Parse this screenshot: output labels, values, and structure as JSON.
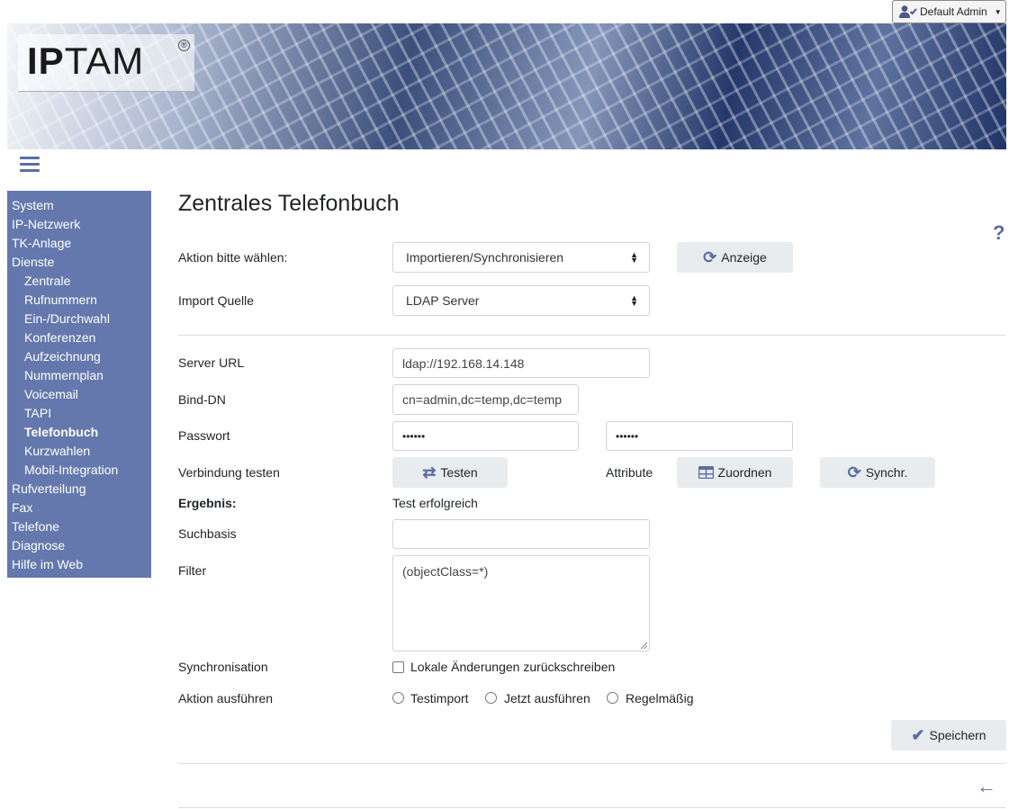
{
  "user_menu": {
    "label": "Default Admin",
    "icon": "user-check-icon"
  },
  "logo": {
    "text_bold": "IP",
    "text_rest": "TAM",
    "mark": "®"
  },
  "sidebar": {
    "items": [
      {
        "label": "System",
        "level": 0
      },
      {
        "label": "IP-Netzwerk",
        "level": 0
      },
      {
        "label": "TK-Anlage",
        "level": 0
      },
      {
        "label": "Dienste",
        "level": 0
      },
      {
        "label": "Zentrale",
        "level": 1
      },
      {
        "label": "Rufnummern",
        "level": 1
      },
      {
        "label": "Ein-/Durchwahl",
        "level": 1
      },
      {
        "label": "Konferenzen",
        "level": 1
      },
      {
        "label": "Aufzeichnung",
        "level": 1
      },
      {
        "label": "Nummernplan",
        "level": 1
      },
      {
        "label": "Voicemail",
        "level": 1
      },
      {
        "label": "TAPI",
        "level": 1
      },
      {
        "label": "Telefonbuch",
        "level": 1,
        "active": true
      },
      {
        "label": "Kurzwahlen",
        "level": 1
      },
      {
        "label": "Mobil-Integration",
        "level": 1
      },
      {
        "label": "Rufverteilung",
        "level": 0
      },
      {
        "label": "Fax",
        "level": 0
      },
      {
        "label": "Telefone",
        "level": 0
      },
      {
        "label": "Diagnose",
        "level": 0
      },
      {
        "label": "Hilfe im Web",
        "level": 0
      }
    ]
  },
  "page": {
    "title": "Zentrales Telefonbuch",
    "help": "?"
  },
  "form": {
    "action_label": "Aktion bitte wählen:",
    "action_value": "Importieren/Synchronisieren",
    "display_button": "Anzeige",
    "source_label": "Import Quelle",
    "source_value": "LDAP Server",
    "server_url_label": "Server URL",
    "server_url_value": "ldap://192.168.14.148",
    "bind_dn_label": "Bind-DN",
    "bind_dn_value": "cn=admin,dc=temp,dc=temp",
    "password_label": "Passwort",
    "password_value": "••••••",
    "password_confirm_value": "••••••",
    "test_conn_label": "Verbindung testen",
    "test_button": "Testen",
    "attribute_label": "Attribute",
    "assign_button": "Zuordnen",
    "sync_button": "Synchr.",
    "result_label": "Ergebnis:",
    "result_value": "Test erfolgreich",
    "search_base_label": "Suchbasis",
    "search_base_value": "",
    "filter_label": "Filter",
    "filter_value": "(objectClass=*)",
    "sync_label": "Synchronisation",
    "writeback_label": "Lokale Änderungen zurückschreiben",
    "writeback_checked": false,
    "run_label": "Aktion ausführen",
    "run_options": [
      "Testimport",
      "Jetzt ausführen",
      "Regelmäßig"
    ],
    "save_button": "Speichern"
  },
  "colors": {
    "accent": "#5b6ea3",
    "sidebar_bg": "#6478ad",
    "button_bg": "#e9ecef"
  }
}
